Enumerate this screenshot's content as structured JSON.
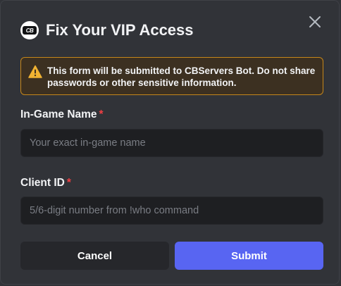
{
  "modal": {
    "title": "Fix Your VIP Access",
    "logo_text": "CB",
    "close_icon": "close-icon"
  },
  "warning": {
    "icon": "warning-triangle-icon",
    "text": "This form will be submitted to CBServers Bot. Do not share passwords or other sensitive information."
  },
  "fields": [
    {
      "label": "In-Game Name",
      "required_marker": "*",
      "value": "",
      "placeholder": "Your exact in-game name"
    },
    {
      "label": "Client ID",
      "required_marker": "*",
      "value": "",
      "placeholder": "5/6-digit number from !who command"
    }
  ],
  "buttons": {
    "cancel_label": "Cancel",
    "submit_label": "Submit"
  },
  "colors": {
    "background": "#313338",
    "warning_border": "#c5861a",
    "warning_bg": "#3c3021",
    "required": "#f23f43",
    "submit": "#5865f2"
  }
}
